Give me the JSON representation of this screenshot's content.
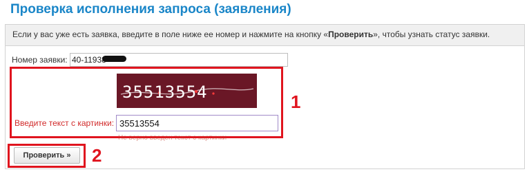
{
  "page": {
    "title": "Проверка исполнения запроса (заявления)"
  },
  "info": {
    "text_before": "Если у вас уже есть заявка, введите в поле ниже ее номер и нажмите на кнопку «",
    "button_ref": "Проверить",
    "text_after": "», чтобы узнать статус заявки."
  },
  "application": {
    "label": "Номер заявки:",
    "value": "40-11938"
  },
  "captcha": {
    "image_text": "35513554",
    "label": "Введите текст с картинки:",
    "value": "35513554",
    "hint": "Не верно введен текст с картинки"
  },
  "actions": {
    "check_label": "Проверить »"
  },
  "annotations": {
    "marker_1": "1",
    "marker_2": "2"
  },
  "colors": {
    "title": "#1a86c8",
    "highlight": "#e0141e",
    "captcha_bg": "#6a1726",
    "captcha_label": "#d12a2a"
  }
}
